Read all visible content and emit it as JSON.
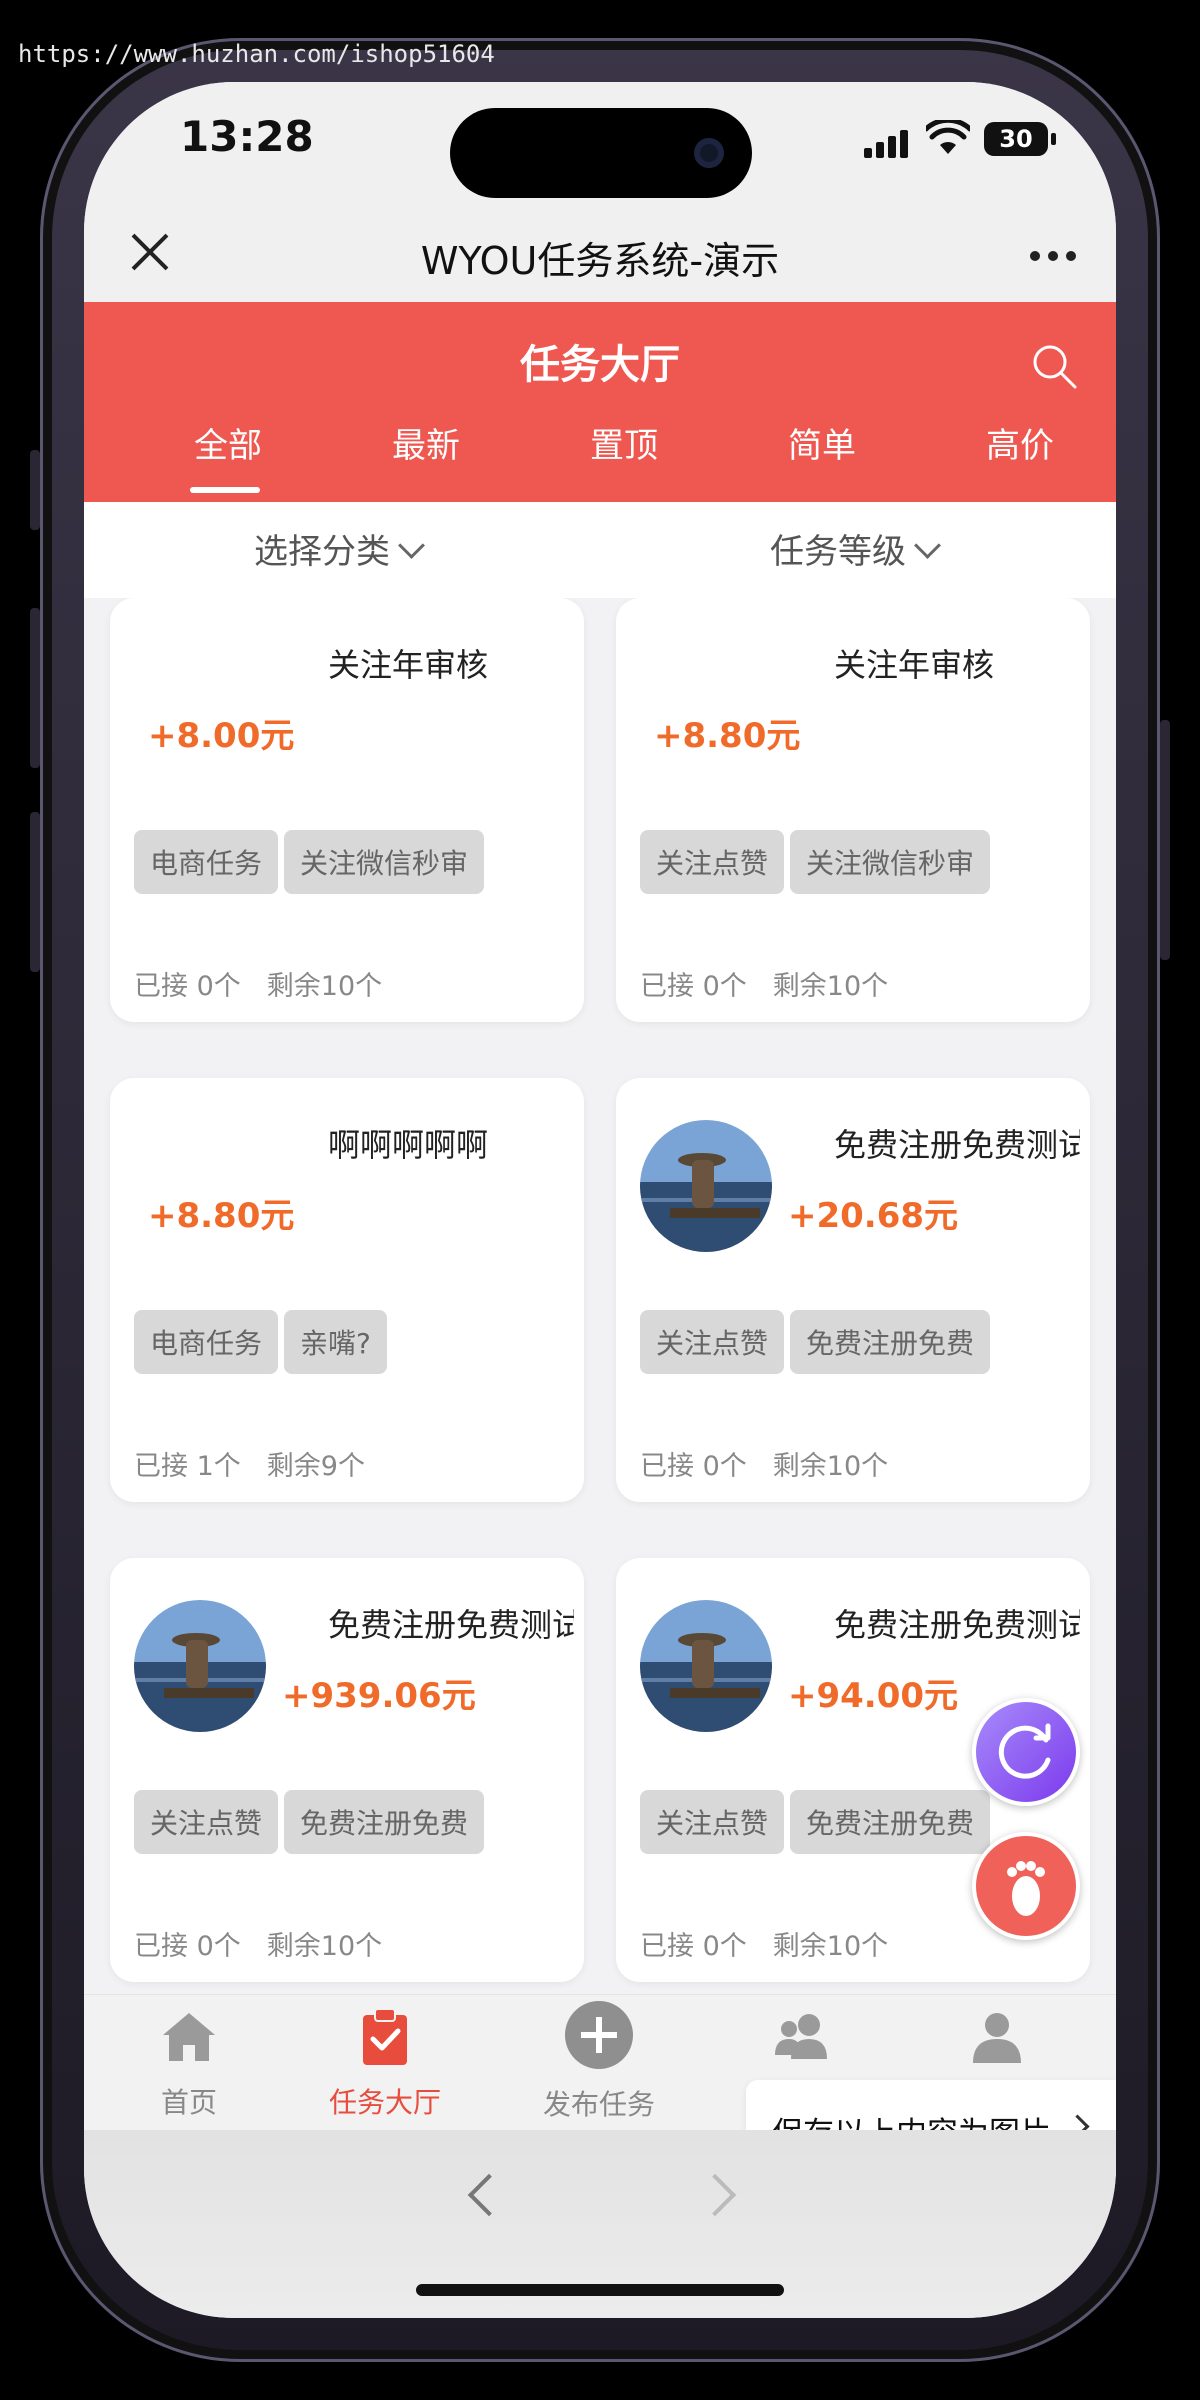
{
  "watermark": "https://www.huzhan.com/ishop51604",
  "status_bar": {
    "time": "13:28",
    "battery": "30"
  },
  "navbar": {
    "title": "WYOU任务系统-演示"
  },
  "header": {
    "title": "任务大厅",
    "tabs": [
      {
        "label": "全部",
        "active": true
      },
      {
        "label": "最新"
      },
      {
        "label": "置顶"
      },
      {
        "label": "简单"
      },
      {
        "label": "高价"
      }
    ]
  },
  "filters": {
    "category": "选择分类",
    "level": "任务等级"
  },
  "tasks": [
    {
      "title": "关注年审核",
      "price": "+8.00元",
      "tags": [
        "电商任务",
        "关注微信秒审"
      ],
      "accepted": "已接 0个",
      "remaining": "剩余10个",
      "has_avatar": false
    },
    {
      "title": "关注年审核",
      "price": "+8.80元",
      "tags": [
        "关注点赞",
        "关注微信秒审"
      ],
      "accepted": "已接 0个",
      "remaining": "剩余10个",
      "has_avatar": false
    },
    {
      "title": "啊啊啊啊啊",
      "price": "+8.80元",
      "tags": [
        "电商任务",
        "亲嘴?"
      ],
      "accepted": "已接 1个",
      "remaining": "剩余9个",
      "has_avatar": false
    },
    {
      "title": "免费注册免费测试",
      "price": "+20.68元",
      "tags": [
        "关注点赞",
        "免费注册免费"
      ],
      "accepted": "已接 0个",
      "remaining": "剩余10个",
      "has_avatar": true
    },
    {
      "title": "免费注册免费测试",
      "price": "+939.06元",
      "tags": [
        "关注点赞",
        "免费注册免费"
      ],
      "accepted": "已接 0个",
      "remaining": "剩余10个",
      "has_avatar": true
    },
    {
      "title": "免费注册免费测试",
      "price": "+94.00元",
      "tags": [
        "关注点赞",
        "免费注册免费"
      ],
      "accepted": "已接 0个",
      "remaining": "剩余10个",
      "has_avatar": true
    }
  ],
  "tabbar": {
    "items": [
      {
        "label": "首页",
        "icon": "home-icon"
      },
      {
        "label": "任务大厅",
        "icon": "task-clipboard-icon",
        "active": true
      },
      {
        "label": "发布任务",
        "icon": "plus-circle-icon"
      },
      {
        "label": "",
        "icon": "users-icon"
      },
      {
        "label": "",
        "icon": "user-icon"
      }
    ]
  },
  "save_tip": "保存以上内容为图片",
  "colors": {
    "accent": "#ef5850",
    "price": "#f06a2a",
    "tag_bg": "#d8d8d8"
  }
}
